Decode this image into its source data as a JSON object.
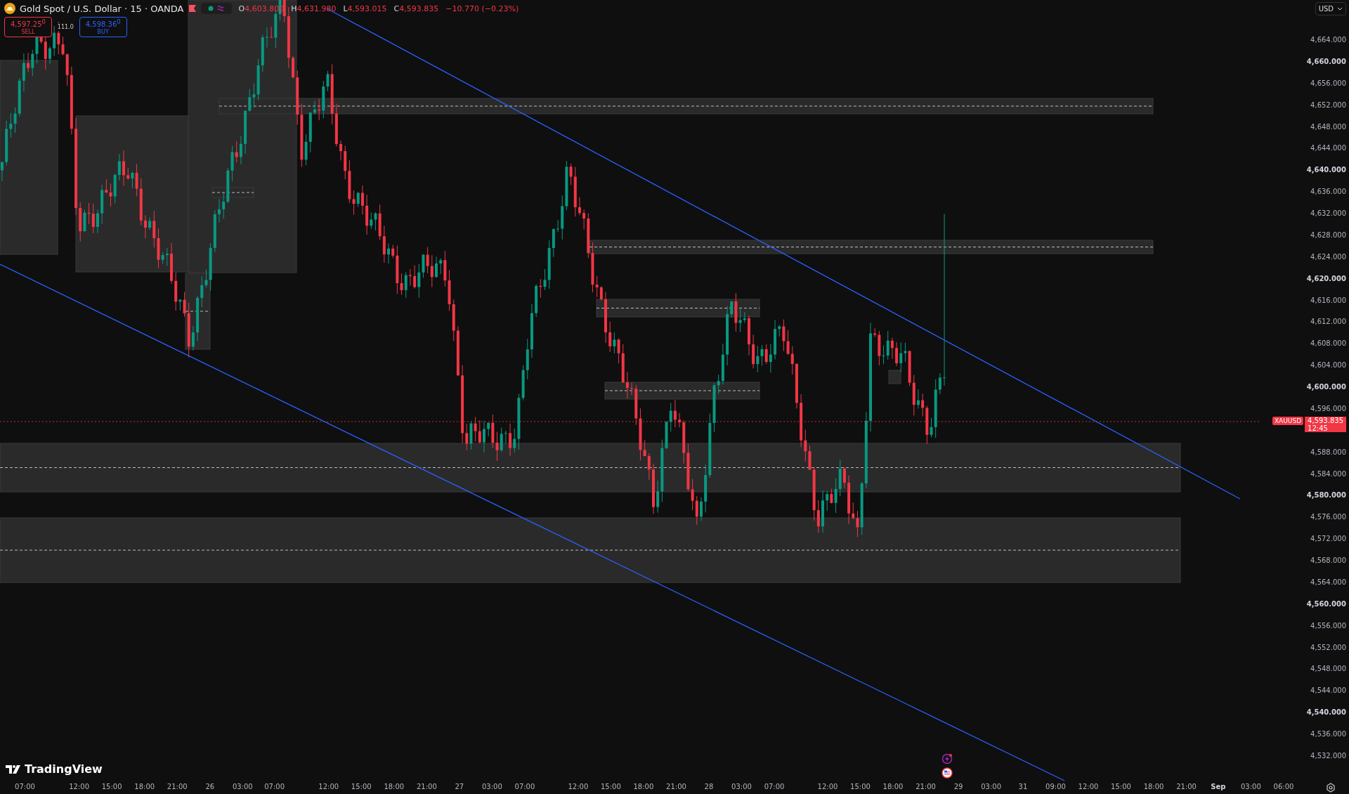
{
  "header": {
    "title": "Gold Spot / U.S. Dollar · 15 · OANDA",
    "ohlc": [
      {
        "label": "O",
        "value": "4,603.800"
      },
      {
        "label": "H",
        "value": "4,631.980"
      },
      {
        "label": "L",
        "value": "4,593.015"
      },
      {
        "label": "C",
        "value": "4,593.835"
      }
    ],
    "change": "−10.770 (−0.23%)"
  },
  "trade": {
    "sell": {
      "price": "4,597.25$^{0}$",
      "label": "SELL"
    },
    "spread": "111.0",
    "buy": {
      "price": "4,598.36$^{0}$",
      "label": "BUY"
    }
  },
  "currency": "USD",
  "price_axis": [
    {
      "label": "4,664.000",
      "major": false
    },
    {
      "label": "4,660.000",
      "major": true
    },
    {
      "label": "4,656.000",
      "major": false
    },
    {
      "label": "4,652.000",
      "major": false
    },
    {
      "label": "4,648.000",
      "major": false
    },
    {
      "label": "4,644.000",
      "major": false
    },
    {
      "label": "4,640.000",
      "major": true
    },
    {
      "label": "4,636.000",
      "major": false
    },
    {
      "label": "4,632.000",
      "major": false
    },
    {
      "label": "4,628.000",
      "major": false
    },
    {
      "label": "4,624.000",
      "major": false
    },
    {
      "label": "4,620.000",
      "major": true
    },
    {
      "label": "4,616.000",
      "major": false
    },
    {
      "label": "4,612.000",
      "major": false
    },
    {
      "label": "4,608.000",
      "major": false
    },
    {
      "label": "4,604.000",
      "major": false
    },
    {
      "label": "4,600.000",
      "major": true
    },
    {
      "label": "4,596.000",
      "major": false
    },
    {
      "label": "4,588.000",
      "major": false
    },
    {
      "label": "4,584.000",
      "major": false
    },
    {
      "label": "4,580.000",
      "major": true
    },
    {
      "label": "4,576.000",
      "major": false
    },
    {
      "label": "4,572.000",
      "major": false
    },
    {
      "label": "4,568.000",
      "major": false
    },
    {
      "label": "4,564.000",
      "major": false
    },
    {
      "label": "4,560.000",
      "major": true
    },
    {
      "label": "4,556.000",
      "major": false
    },
    {
      "label": "4,552.000",
      "major": false
    },
    {
      "label": "4,548.000",
      "major": false
    },
    {
      "label": "4,544.000",
      "major": false
    },
    {
      "label": "4,540.000",
      "major": true
    },
    {
      "label": "4,536.000",
      "major": false
    },
    {
      "label": "4,532.000",
      "major": false
    }
  ],
  "price_tag": {
    "symbol": "XAUUSD",
    "price": "4,593.835",
    "countdown": "12:45"
  },
  "time_axis": [
    {
      "label": "07:00",
      "major": false
    },
    {
      "label": "12:00",
      "major": false
    },
    {
      "label": "15:00",
      "major": false
    },
    {
      "label": "18:00",
      "major": false
    },
    {
      "label": "21:00",
      "major": false
    },
    {
      "label": "26",
      "major": false
    },
    {
      "label": "03:00",
      "major": false
    },
    {
      "label": "07:00",
      "major": false
    },
    {
      "label": "12:00",
      "major": false
    },
    {
      "label": "15:00",
      "major": false
    },
    {
      "label": "18:00",
      "major": false
    },
    {
      "label": "21:00",
      "major": false
    },
    {
      "label": "27",
      "major": false
    },
    {
      "label": "03:00",
      "major": false
    },
    {
      "label": "07:00",
      "major": false
    },
    {
      "label": "12:00",
      "major": false
    },
    {
      "label": "15:00",
      "major": false
    },
    {
      "label": "18:00",
      "major": false
    },
    {
      "label": "21:00",
      "major": false
    },
    {
      "label": "28",
      "major": false
    },
    {
      "label": "03:00",
      "major": false
    },
    {
      "label": "07:00",
      "major": false
    },
    {
      "label": "12:00",
      "major": false
    },
    {
      "label": "15:00",
      "major": false
    },
    {
      "label": "18:00",
      "major": false
    },
    {
      "label": "21:00",
      "major": false
    },
    {
      "label": "29",
      "major": false
    },
    {
      "label": "03:00",
      "major": false
    },
    {
      "label": "31",
      "major": false
    },
    {
      "label": "09:00",
      "major": false
    },
    {
      "label": "12:00",
      "major": false
    },
    {
      "label": "15:00",
      "major": false
    },
    {
      "label": "18:00",
      "major": false
    },
    {
      "label": "21:00",
      "major": false
    },
    {
      "label": "Sep",
      "major": true
    },
    {
      "label": "03:00",
      "major": false
    },
    {
      "label": "06:00",
      "major": false
    }
  ],
  "logo": "TradingView"
}
